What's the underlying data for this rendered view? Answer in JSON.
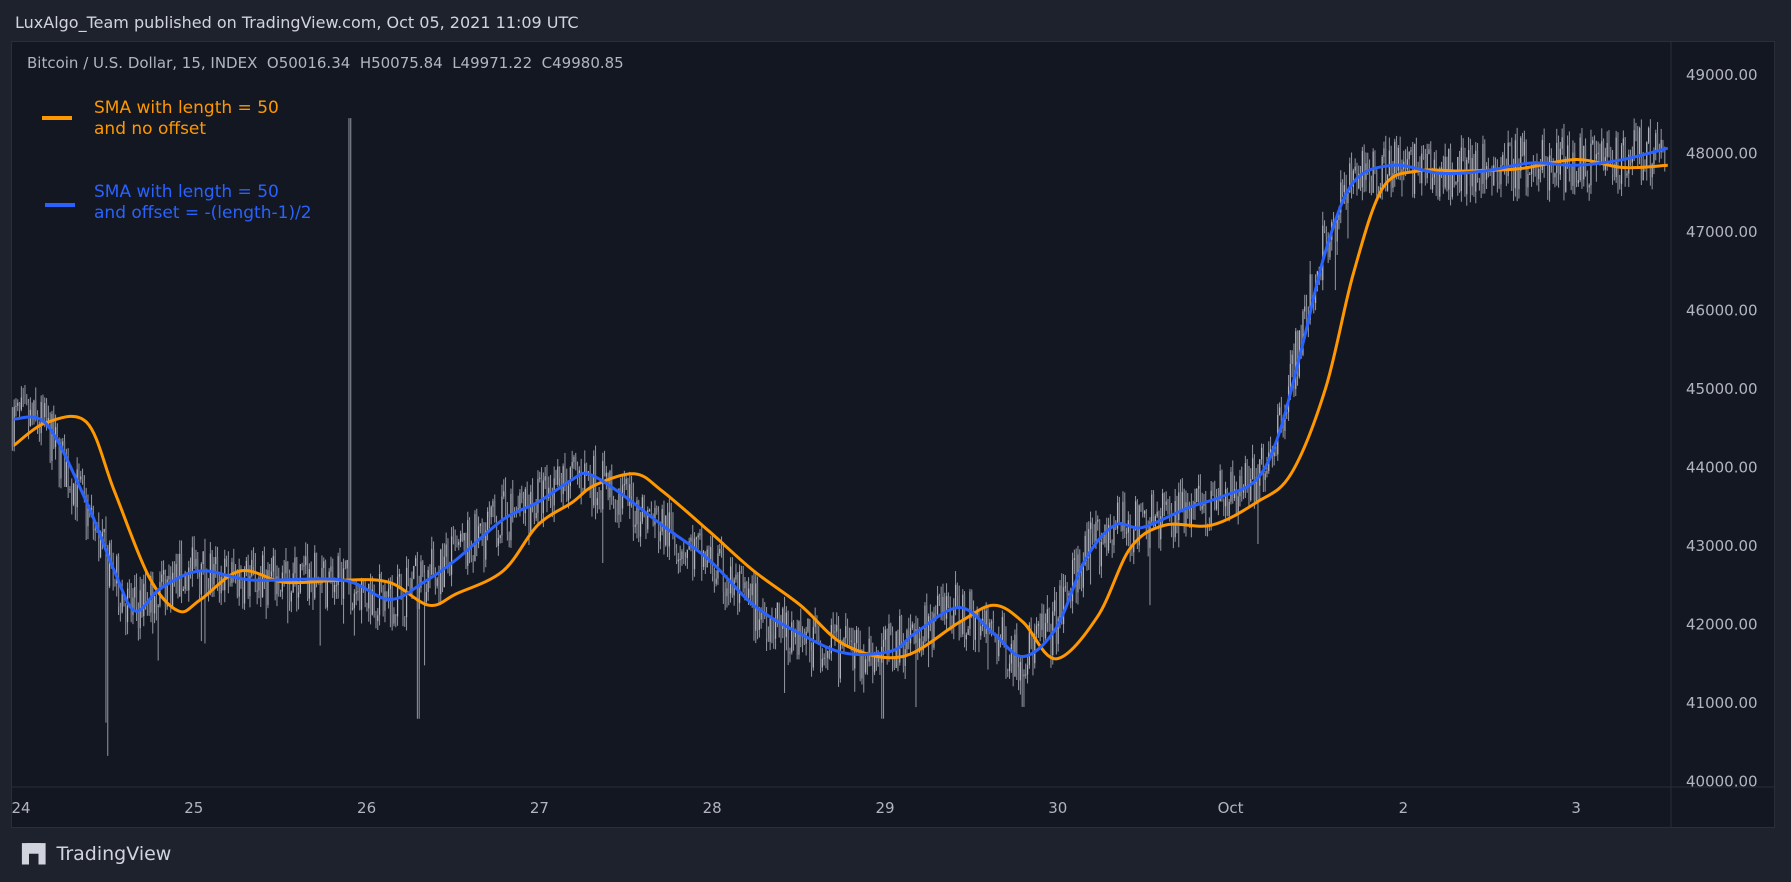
{
  "header": {
    "title": "LuxAlgo_Team published on TradingView.com, Oct 05, 2021 11:09 UTC"
  },
  "symbol_line": "Bitcoin / U.S. Dollar, 15, INDEX  O50016.34  H50075.84  L49971.22  C49980.85",
  "legend": [
    {
      "line1": "SMA with length = 50",
      "line2": "and no offset",
      "color": "#ff9800"
    },
    {
      "line1": "SMA with length = 50",
      "line2": "and offset = -(length-1)/2",
      "color": "#2962ff"
    }
  ],
  "footer": {
    "brand": "TradingView",
    "logo": "TV"
  },
  "chart_data": {
    "type": "line",
    "title": "Bitcoin / U.S. Dollar, 15, INDEX",
    "x_unit": "days since Sep 24",
    "x_ticks": [
      {
        "d": 0,
        "label": "24"
      },
      {
        "d": 1,
        "label": "25"
      },
      {
        "d": 2,
        "label": "26"
      },
      {
        "d": 3,
        "label": "27"
      },
      {
        "d": 4,
        "label": "28"
      },
      {
        "d": 5,
        "label": "29"
      },
      {
        "d": 6,
        "label": "30"
      },
      {
        "d": 7,
        "label": "Oct"
      },
      {
        "d": 8,
        "label": "2"
      },
      {
        "d": 9,
        "label": "3"
      }
    ],
    "y_ticks": [
      "49000.00",
      "48000.00",
      "47000.00",
      "46000.00",
      "45000.00",
      "44000.00",
      "43000.00",
      "42000.00",
      "41000.00",
      "40000.00"
    ],
    "ylim": [
      40000,
      49000
    ],
    "xlim": [
      -0.06,
      9.55
    ],
    "grid": false,
    "series": [
      {
        "name": "SMA with length = 50 and no offset",
        "color": "#ff9800",
        "points": [
          [
            -0.04,
            44284
          ],
          [
            0.15,
            44575
          ],
          [
            0.38,
            44575
          ],
          [
            0.54,
            43702
          ],
          [
            0.74,
            42610
          ],
          [
            0.91,
            42173
          ],
          [
            1.04,
            42319
          ],
          [
            1.27,
            42683
          ],
          [
            1.53,
            42537
          ],
          [
            1.86,
            42566
          ],
          [
            2.13,
            42537
          ],
          [
            2.36,
            42246
          ],
          [
            2.52,
            42392
          ],
          [
            2.79,
            42683
          ],
          [
            2.99,
            43265
          ],
          [
            3.19,
            43556
          ],
          [
            3.32,
            43774
          ],
          [
            3.55,
            43920
          ],
          [
            3.71,
            43702
          ],
          [
            3.98,
            43192
          ],
          [
            4.24,
            42683
          ],
          [
            4.51,
            42246
          ],
          [
            4.77,
            41737
          ],
          [
            5.1,
            41591
          ],
          [
            5.43,
            42028
          ],
          [
            5.63,
            42246
          ],
          [
            5.8,
            42028
          ],
          [
            5.99,
            41562
          ],
          [
            6.23,
            42101
          ],
          [
            6.42,
            42974
          ],
          [
            6.62,
            43265
          ],
          [
            6.89,
            43265
          ],
          [
            7.15,
            43556
          ],
          [
            7.35,
            43920
          ],
          [
            7.55,
            45012
          ],
          [
            7.71,
            46467
          ],
          [
            7.88,
            47559
          ],
          [
            8.08,
            47777
          ],
          [
            8.34,
            47777
          ],
          [
            8.67,
            47806
          ],
          [
            9.0,
            47923
          ],
          [
            9.27,
            47821
          ],
          [
            9.53,
            47850
          ]
        ]
      },
      {
        "name": "SMA with length = 50 and offset = -(length-1)/2",
        "color": "#2962ff",
        "points": [
          [
            -0.04,
            44619
          ],
          [
            0.15,
            44546
          ],
          [
            0.38,
            43557
          ],
          [
            0.54,
            42683
          ],
          [
            0.66,
            42173
          ],
          [
            0.81,
            42464
          ],
          [
            1.04,
            42683
          ],
          [
            1.34,
            42566
          ],
          [
            1.86,
            42566
          ],
          [
            2.13,
            42319
          ],
          [
            2.33,
            42537
          ],
          [
            2.52,
            42828
          ],
          [
            2.79,
            43338
          ],
          [
            2.99,
            43556
          ],
          [
            3.19,
            43847
          ],
          [
            3.28,
            43920
          ],
          [
            3.45,
            43702
          ],
          [
            3.71,
            43265
          ],
          [
            3.98,
            42828
          ],
          [
            4.24,
            42246
          ],
          [
            4.51,
            41882
          ],
          [
            4.77,
            41635
          ],
          [
            5.04,
            41664
          ],
          [
            5.17,
            41882
          ],
          [
            5.43,
            42217
          ],
          [
            5.63,
            41882
          ],
          [
            5.8,
            41591
          ],
          [
            5.99,
            41955
          ],
          [
            6.16,
            42828
          ],
          [
            6.33,
            43265
          ],
          [
            6.49,
            43236
          ],
          [
            6.75,
            43483
          ],
          [
            6.95,
            43629
          ],
          [
            7.15,
            43847
          ],
          [
            7.28,
            44429
          ],
          [
            7.42,
            45594
          ],
          [
            7.55,
            46758
          ],
          [
            7.71,
            47632
          ],
          [
            7.94,
            47850
          ],
          [
            8.21,
            47748
          ],
          [
            8.47,
            47777
          ],
          [
            8.74,
            47879
          ],
          [
            9.0,
            47850
          ],
          [
            9.27,
            47923
          ],
          [
            9.53,
            48068
          ]
        ]
      }
    ],
    "price_extremes": [
      [
        0.5,
        40750
      ],
      [
        2.3,
        40800
      ],
      [
        4.99,
        40800
      ],
      [
        5.8,
        40950
      ],
      [
        1.9,
        48450
      ]
    ]
  }
}
